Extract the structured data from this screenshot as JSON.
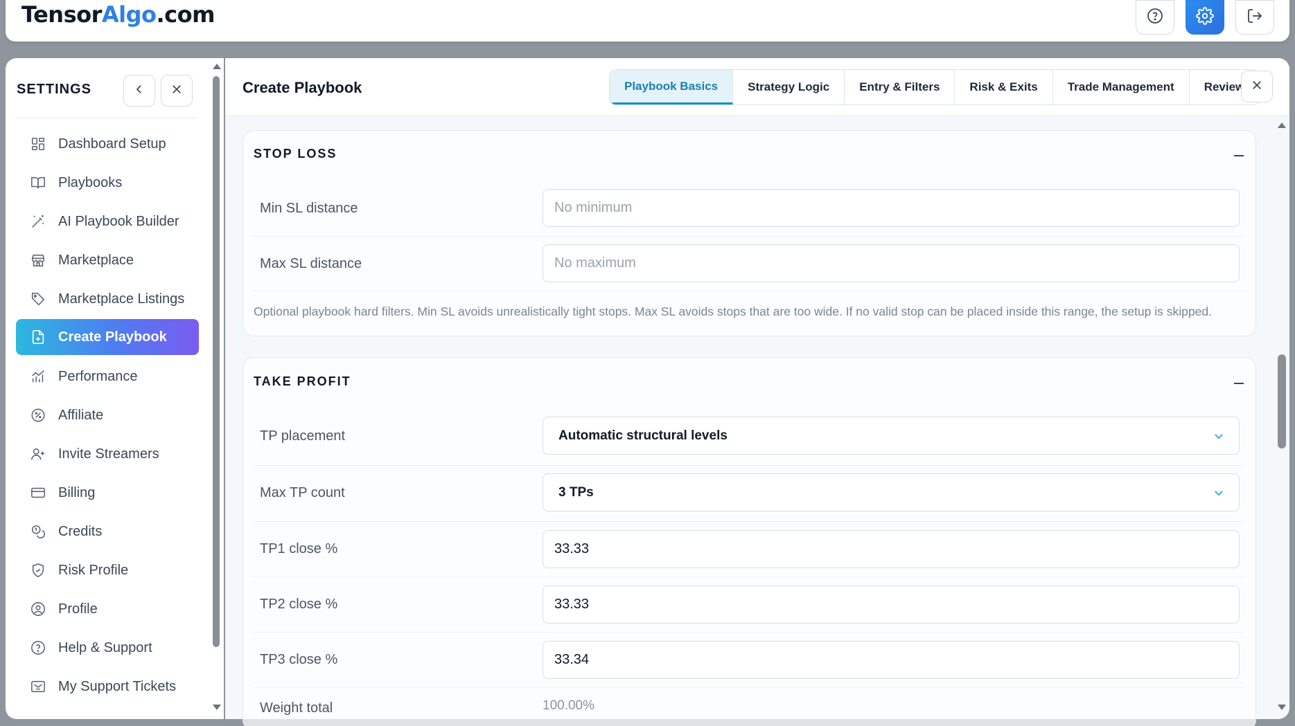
{
  "app": {
    "logo_part1": "Tensor",
    "logo_part2": "Algo",
    "logo_part3": ".com",
    "accent": "#2f7fe6"
  },
  "top_actions": {
    "help_icon": "help-circle-icon",
    "settings_icon": "gear-icon",
    "logout_icon": "logout-icon"
  },
  "sidebar": {
    "title": "SETTINGS",
    "items": [
      {
        "label": "Dashboard Setup",
        "icon": "grid-icon"
      },
      {
        "label": "Playbooks",
        "icon": "book-icon"
      },
      {
        "label": "AI Playbook Builder",
        "icon": "magic-wand-icon"
      },
      {
        "label": "Marketplace",
        "icon": "store-icon"
      },
      {
        "label": "Marketplace Listings",
        "icon": "tag-icon"
      },
      {
        "label": "Create Playbook",
        "icon": "file-plus-icon",
        "active": true
      },
      {
        "label": "Performance",
        "icon": "bar-chart-icon"
      },
      {
        "label": "Affiliate",
        "icon": "percent-badge-icon"
      },
      {
        "label": "Invite Streamers",
        "icon": "user-plus-icon"
      },
      {
        "label": "Billing",
        "icon": "credit-card-icon"
      },
      {
        "label": "Credits",
        "icon": "coins-icon"
      },
      {
        "label": "Risk Profile",
        "icon": "shield-icon"
      },
      {
        "label": "Profile",
        "icon": "user-circle-icon"
      },
      {
        "label": "Help & Support",
        "icon": "help-circle-icon"
      },
      {
        "label": "My Support Tickets",
        "icon": "ticket-icon"
      }
    ]
  },
  "main": {
    "title": "Create Playbook",
    "tabs": [
      {
        "label": "Playbook Basics",
        "active": true
      },
      {
        "label": "Strategy Logic"
      },
      {
        "label": "Entry & Filters"
      },
      {
        "label": "Risk & Exits"
      },
      {
        "label": "Trade Management"
      },
      {
        "label": "Review"
      }
    ]
  },
  "stop_loss": {
    "title": "STOP LOSS",
    "min_label": "Min SL distance",
    "min_placeholder": "No minimum",
    "max_label": "Max SL distance",
    "max_placeholder": "No maximum",
    "note": "Optional playbook hard filters. Min SL avoids unrealistically tight stops. Max SL avoids stops that are too wide. If no valid stop can be placed inside this range, the setup is skipped."
  },
  "take_profit": {
    "title": "TAKE PROFIT",
    "tp_placement_label": "TP placement",
    "tp_placement_value": "Automatic structural levels",
    "max_tp_label": "Max TP count",
    "max_tp_value": "3 TPs",
    "tp1_label": "TP1 close %",
    "tp1_value": "33.33",
    "tp2_label": "TP2 close %",
    "tp2_value": "33.33",
    "tp3_label": "TP3 close %",
    "tp3_value": "33.34",
    "weight_label": "Weight total",
    "weight_value": "100.00%"
  }
}
